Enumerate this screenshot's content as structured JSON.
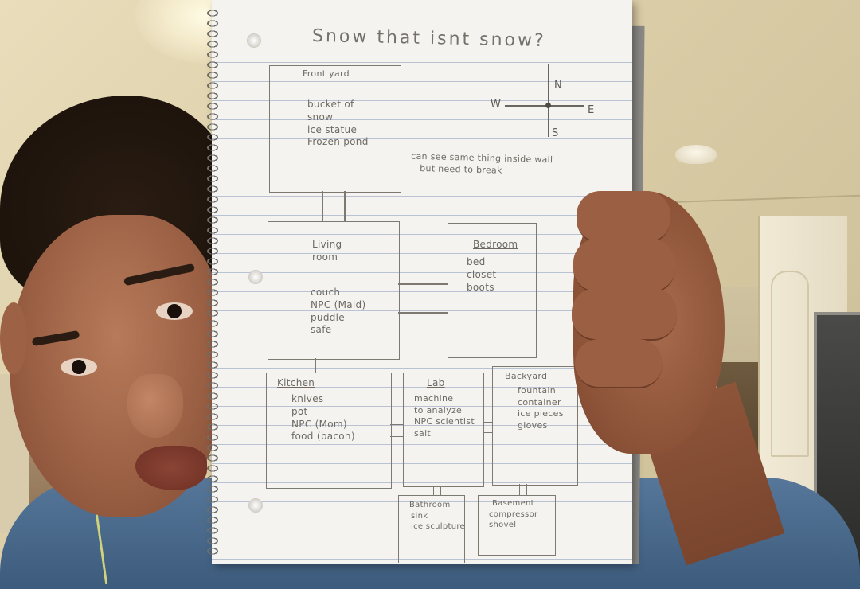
{
  "notebook": {
    "title": "Snow that isnt snow?",
    "compass": {
      "north": "N",
      "south": "S",
      "east": "E",
      "west": "W"
    },
    "rooms": {
      "front_yard": {
        "name": "Front yard",
        "items": "bucket of\nsnow\nice statue\nFrozen pond"
      },
      "living_room": {
        "name": "Living\nroom",
        "items": "couch\nNPC (Maid)\npuddle\nsafe"
      },
      "bedroom": {
        "name": "Bedroom",
        "items": "bed\ncloset\nboots"
      },
      "kitchen": {
        "name": "Kitchen",
        "items": "knives\npot\nNPC (Mom)\nfood (bacon)"
      },
      "lab": {
        "name": "Lab",
        "items": "machine\nto analyze\nNPC scientist\nsalt"
      },
      "backyard": {
        "name": "Backyard",
        "items": "fountain\ncontainer\nice pieces\ngloves"
      },
      "bathroom": {
        "name": "Bathroom",
        "items": "sink\nice sculpture"
      },
      "basement": {
        "name": "Basement",
        "items": "compressor\nshovel"
      }
    },
    "note": "can see same thing inside wall\n   but need to break"
  }
}
